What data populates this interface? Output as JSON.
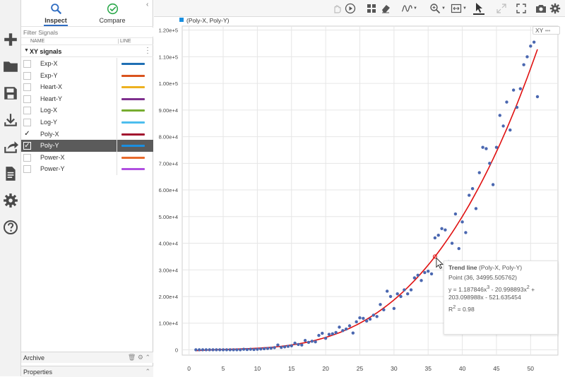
{
  "panel": {
    "tabs": [
      {
        "label": "Inspect",
        "icon": "search-icon",
        "active": true
      },
      {
        "label": "Compare",
        "icon": "check-circle-icon",
        "active": false
      }
    ],
    "filter_placeholder": "Filter Signals",
    "columns": {
      "name": "NAME",
      "line": "LINE"
    },
    "group_label": "XY signals",
    "signals": [
      {
        "name": "Exp-X",
        "checked": false,
        "selected": false,
        "color": "#1f6fb4"
      },
      {
        "name": "Exp-Y",
        "checked": false,
        "selected": false,
        "color": "#d9531e"
      },
      {
        "name": "Heart-X",
        "checked": false,
        "selected": false,
        "color": "#edb120"
      },
      {
        "name": "Heart-Y",
        "checked": false,
        "selected": false,
        "color": "#7e2f8e"
      },
      {
        "name": "Log-X",
        "checked": false,
        "selected": false,
        "color": "#77ac30"
      },
      {
        "name": "Log-Y",
        "checked": false,
        "selected": false,
        "color": "#4dbeee"
      },
      {
        "name": "Poly-X",
        "checked": true,
        "selected": false,
        "color": "#a2142f"
      },
      {
        "name": "Poly-Y",
        "checked": true,
        "selected": true,
        "color": "#1a8fe0"
      },
      {
        "name": "Power-X",
        "checked": false,
        "selected": false,
        "color": "#e86a2c"
      },
      {
        "name": "Power-Y",
        "checked": false,
        "selected": false,
        "color": "#b04fe0"
      }
    ],
    "archive_label": "Archive",
    "properties_label": "Properties"
  },
  "rail_icons": [
    "plus-icon",
    "folder-icon",
    "save-icon",
    "download-icon",
    "share-icon",
    "document-icon",
    "gear-icon",
    "help-icon"
  ],
  "toolbar_icons": [
    "pan-hand-icon",
    "play-icon",
    "layout-grid-icon",
    "eraser-icon",
    "signal-wave-icon",
    "zoom-icon",
    "fit-view-icon",
    "cursor-icon",
    "expand-icon",
    "fullscreen-icon",
    "camera-icon",
    "settings-icon"
  ],
  "xy_tag": {
    "label": "XY",
    "more": "•••"
  },
  "tooltip": {
    "title": "Trend line",
    "series": "(Poly-X, Poly-Y)",
    "point": "Point (36, 34995.505762)",
    "eq_part1": "y = 1.187846x",
    "eq_exp1": "3",
    "eq_part2": " - 20.998893x",
    "eq_exp2": "2",
    "eq_part3": " +",
    "eq_line2": "203.098988x - 521.635454",
    "r2_label": "R",
    "r2_exp": "2",
    "r2_value": " = 0.98"
  },
  "chart_data": {
    "type": "scatter",
    "legend": [
      "(Poly-X, Poly-Y)"
    ],
    "legend_position": "top-left",
    "series_color": "#4a67b0",
    "trend_color": "#e01010",
    "grid": true,
    "xlim": [
      -1,
      54
    ],
    "ylim": [
      -2000,
      121500
    ],
    "x_ticks": [
      0,
      5,
      10,
      15,
      20,
      25,
      30,
      35,
      40,
      45,
      50
    ],
    "y_ticks": [
      0,
      10000,
      20000,
      30000,
      40000,
      50000,
      60000,
      70000,
      80000,
      90000,
      100000,
      110000,
      120000
    ],
    "y_tick_labels": [
      "0",
      "1.00e+4",
      "2.00e+4",
      "3.00e+4",
      "4.00e+4",
      "5.00e+4",
      "6.00e+4",
      "7.00e+4",
      "8.00e+4",
      "9.00e+4",
      "1.00e+5",
      "1.10e+5",
      "1.20e+5"
    ],
    "trend": {
      "a3": 1.187846,
      "a2": -20.998893,
      "a1": 203.098988,
      "a0": -521.635454,
      "r2": 0.98
    },
    "x": [
      1,
      1.5,
      2,
      2.5,
      3,
      3.5,
      4,
      4.5,
      5,
      5.5,
      6,
      6.5,
      7,
      7.5,
      8,
      8.5,
      9,
      9.5,
      10,
      10.5,
      11,
      11.5,
      12,
      12.5,
      13,
      13.5,
      14,
      14.5,
      15,
      15.5,
      16,
      16.5,
      17,
      17.5,
      18,
      18.5,
      19,
      19.5,
      20,
      20.5,
      21,
      21.5,
      22,
      22.5,
      23,
      23.5,
      24,
      24.5,
      25,
      25.5,
      26,
      26.5,
      27,
      27.5,
      28,
      28.5,
      29,
      29.5,
      30,
      30.5,
      31,
      31.5,
      32,
      32.5,
      33,
      33.5,
      34,
      34.5,
      35,
      35.5,
      36,
      36.5,
      37,
      37.5,
      38,
      38.5,
      39,
      39.5,
      40,
      40.5,
      41,
      41.5,
      42,
      42.5,
      43,
      43.5,
      44,
      44.5,
      45,
      45.5,
      46,
      46.5,
      47,
      47.5,
      48,
      48.5,
      49,
      49.5,
      50,
      50.5,
      51
    ],
    "y": [
      0,
      0,
      0,
      0,
      0,
      0,
      0,
      0,
      0,
      0,
      0,
      0,
      0,
      0,
      200,
      100,
      200,
      100,
      200,
      300,
      400,
      500,
      600,
      800,
      1800,
      900,
      1100,
      1300,
      1500,
      2500,
      2000,
      1800,
      3500,
      2800,
      3200,
      3000,
      5400,
      6200,
      4300,
      5800,
      6000,
      6500,
      8500,
      7200,
      7800,
      9000,
      6300,
      10500,
      12000,
      11800,
      10800,
      11500,
      13000,
      12500,
      17000,
      15000,
      22000,
      20000,
      15500,
      21000,
      20000,
      22500,
      21000,
      22500,
      27000,
      28000,
      26000,
      29000,
      29500,
      28500,
      42000,
      43000,
      45500,
      45000,
      33000,
      40000,
      51000,
      38000,
      48000,
      44000,
      58000,
      60500,
      53000,
      66500,
      76000,
      75500,
      70000,
      62000,
      76000,
      88000,
      84000,
      93000,
      82500,
      97500,
      91000,
      98000,
      107000,
      110000,
      114000,
      115500,
      95000
    ]
  }
}
